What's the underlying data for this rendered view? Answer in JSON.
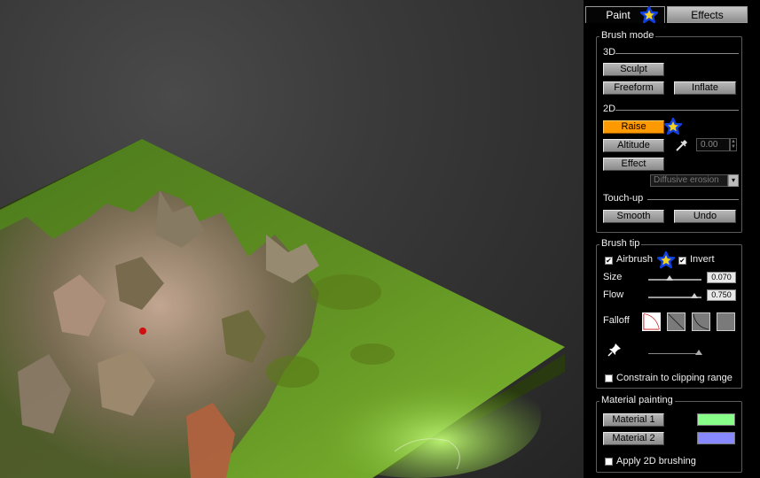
{
  "tabs": {
    "paint": "Paint",
    "effects": "Effects"
  },
  "brush_mode": {
    "title": "Brush mode",
    "section_3d": "3D",
    "sculpt": "Sculpt",
    "freeform": "Freeform",
    "inflate": "Inflate",
    "section_2d": "2D",
    "raise": "Raise",
    "altitude": "Altitude",
    "altitude_value": "0.00",
    "effect": "Effect",
    "effect_select": "Diffusive erosion",
    "section_touchup": "Touch-up",
    "smooth": "Smooth",
    "undo": "Undo"
  },
  "brush_tip": {
    "title": "Brush tip",
    "airbrush": "Airbrush",
    "airbrush_checked": true,
    "invert": "Invert",
    "invert_checked": true,
    "size_label": "Size",
    "size_value": "0.070",
    "flow_label": "Flow",
    "flow_value": "0.750",
    "falloff_label": "Falloff",
    "constrain": "Constrain to clipping range",
    "constrain_checked": false
  },
  "material_painting": {
    "title": "Material painting",
    "material1": "Material 1",
    "material1_color": "#88ff88",
    "material2": "Material 2",
    "material2_color": "#8888ff",
    "apply2d": "Apply 2D brushing",
    "apply2d_checked": false
  },
  "colors": {
    "accent_orange": "#ff9900",
    "marker_blue": "#1040e0",
    "marker_gold": "#f0d020",
    "panel_bg": "#000000"
  },
  "icons": [
    "star-marker-icon",
    "eyedropper-icon",
    "checkmark-icon",
    "pin-icon",
    "dropdown-arrow-icon",
    "spinner-arrows-icon"
  ]
}
